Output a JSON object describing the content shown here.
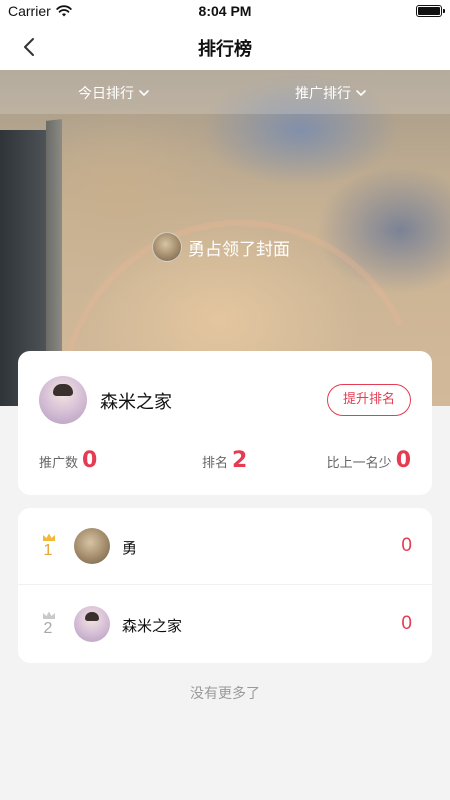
{
  "status_bar": {
    "carrier": "Carrier",
    "time": "8:04 PM"
  },
  "nav": {
    "title": "排行榜"
  },
  "filters": {
    "today": "今日排行",
    "promotion": "推广排行"
  },
  "cover": {
    "text": "勇占领了封面"
  },
  "profile": {
    "name": "森米之家",
    "boost_label": "提升排名",
    "promo_label": "推广数",
    "promo_value": "0",
    "rank_label": "排名",
    "rank_value": "2",
    "gap_label": "比上一名少",
    "gap_value": "0"
  },
  "ranking": [
    {
      "rank": "1",
      "name": "勇",
      "score": "0"
    },
    {
      "rank": "2",
      "name": "森米之家",
      "score": "0"
    }
  ],
  "footer": {
    "no_more": "没有更多了"
  },
  "colors": {
    "accent": "#e43c52",
    "gold": "#e8a531",
    "silver": "#a8a8a8"
  }
}
